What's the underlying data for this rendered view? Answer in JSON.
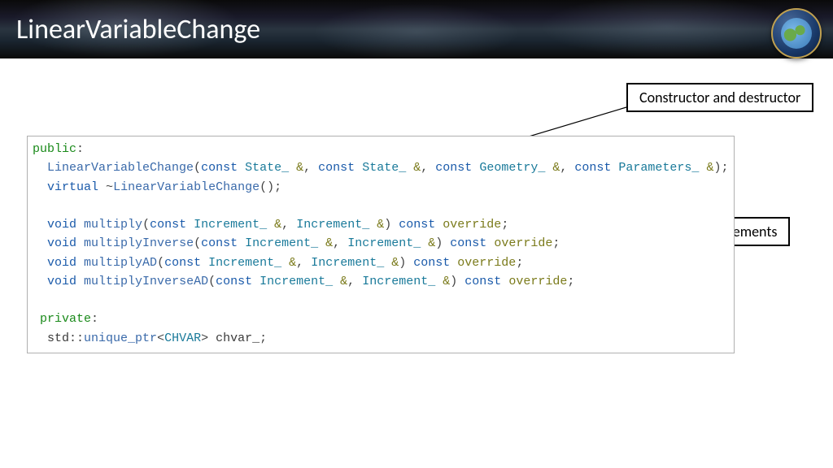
{
  "header": {
    "title": "LinearVariableChange"
  },
  "callouts": {
    "constructor": "Constructor and destructor",
    "convert": "Convert increments"
  },
  "code": {
    "kw_public": "public",
    "kw_private": "private",
    "kw_const": "const",
    "kw_virtual": "virtual",
    "kw_void": "void",
    "kw_override": "override",
    "ctor_name": "LinearVariableChange",
    "dtor_name": "LinearVariableChange",
    "type_state": "State_",
    "type_geom": "Geometry_",
    "type_params": "Parameters_",
    "type_incr": "Increment_",
    "type_chvar": "CHVAR",
    "fn_multiply": "multiply",
    "fn_multiplyInverse": "multiplyInverse",
    "fn_multiplyAD": "multiplyAD",
    "fn_multiplyInverseAD": "multiplyInverseAD",
    "ns_std": "std",
    "tmpl_unique_ptr": "unique_ptr",
    "member_chvar": "chvar_",
    "amp": "&",
    "tilde": "~",
    "colon": ":",
    "dcolon": "::",
    "lt": "<",
    "gt": ">",
    "lparen": "(",
    "rparen": ")",
    "semi": ";",
    "comma": ",",
    "sp": " ",
    "sp2": "  ",
    "sp_private": " "
  }
}
